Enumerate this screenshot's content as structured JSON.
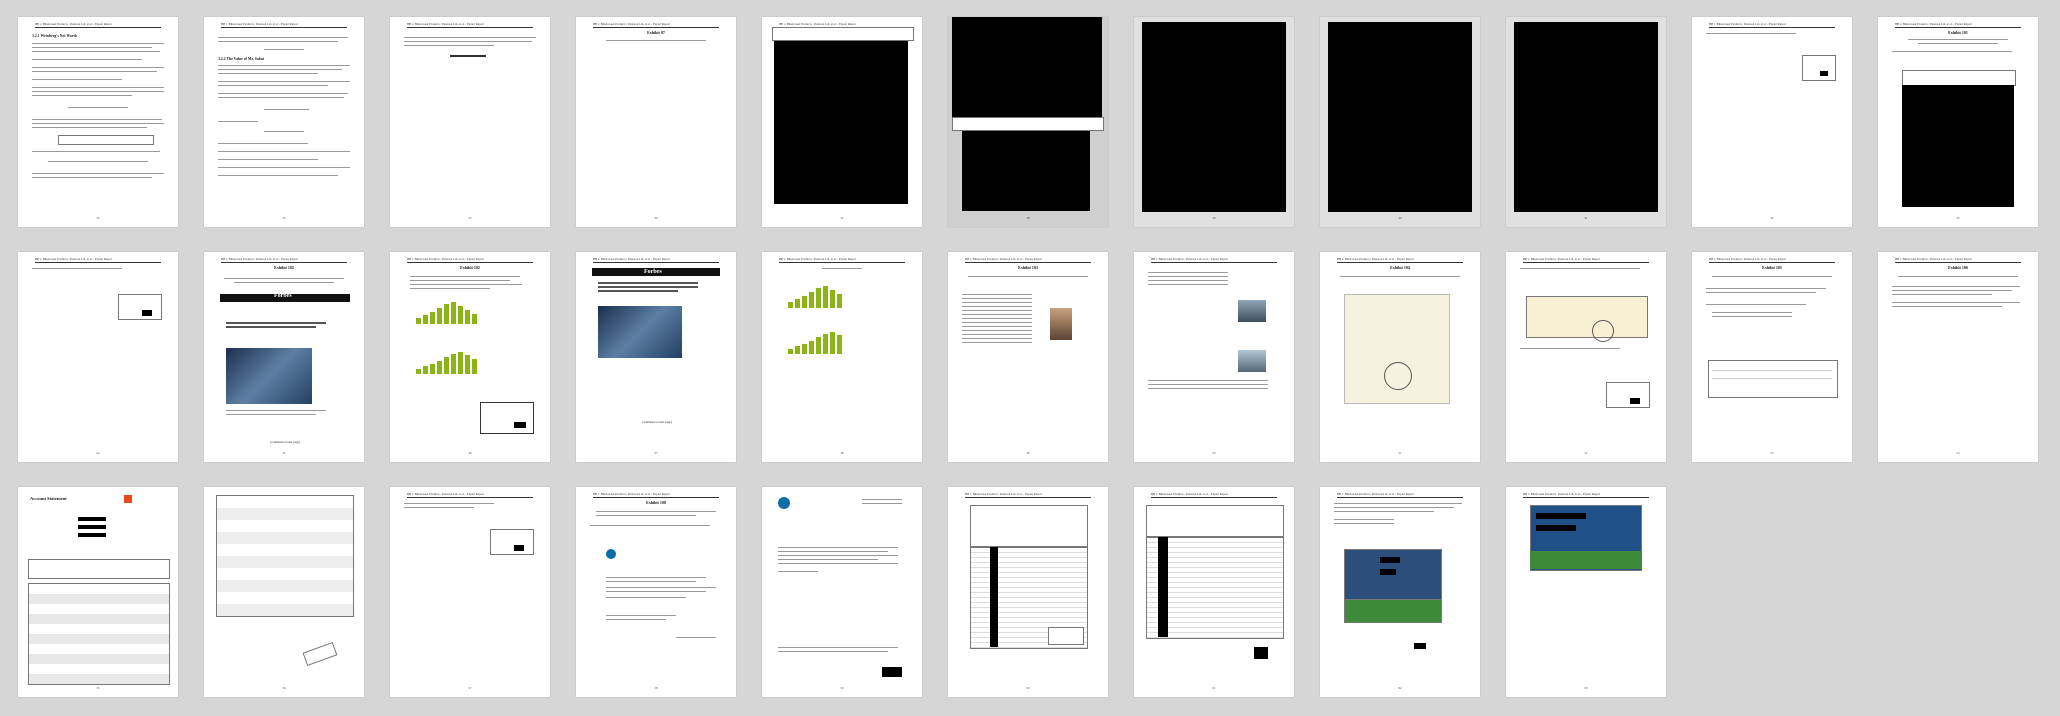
{
  "document": {
    "header": "HB v. Bittersweet Products / Paterson Ltd, et al. - Expert Report",
    "pages": [
      {
        "num": "33"
      },
      {
        "num": "34"
      },
      {
        "num": "35"
      },
      {
        "num": "36"
      },
      {
        "num": "37"
      },
      {
        "num": "38"
      },
      {
        "num": "39"
      },
      {
        "num": "40"
      },
      {
        "num": "41"
      },
      {
        "num": "42"
      },
      {
        "num": "43"
      },
      {
        "num": "44"
      },
      {
        "num": "45"
      },
      {
        "num": "46"
      },
      {
        "num": "47"
      },
      {
        "num": "48"
      },
      {
        "num": "49"
      },
      {
        "num": "50"
      },
      {
        "num": "51"
      },
      {
        "num": "52"
      },
      {
        "num": "53"
      },
      {
        "num": "54"
      },
      {
        "num": "55"
      },
      {
        "num": "56"
      },
      {
        "num": "57"
      },
      {
        "num": "58"
      },
      {
        "num": "59"
      },
      {
        "num": "60"
      },
      {
        "num": "61"
      },
      {
        "num": "62"
      },
      {
        "num": "63"
      }
    ]
  },
  "content": {
    "exhibit_97": "Exhibit 97",
    "exhibit_101": "Exhibit 101",
    "exhibit_102": "Exhibit 102",
    "exhibit_103": "Exhibit 103",
    "exhibit_104": "Exhibit 104",
    "exhibit_105": "Exhibit 105",
    "exhibit_106": "Exhibit 106",
    "exhibit_107": "Exhibit 107",
    "exhibit_108": "Exhibit 108",
    "exhibit_109": "Exhibit 109",
    "forbes": "Forbes",
    "account_statement": "Account Statement",
    "sec_a": "3.2.1  Weinberg's Net Worth",
    "sec_b": "3.2.2  The Value of Mr. Sabat",
    "continued": "(continued on next page)"
  }
}
